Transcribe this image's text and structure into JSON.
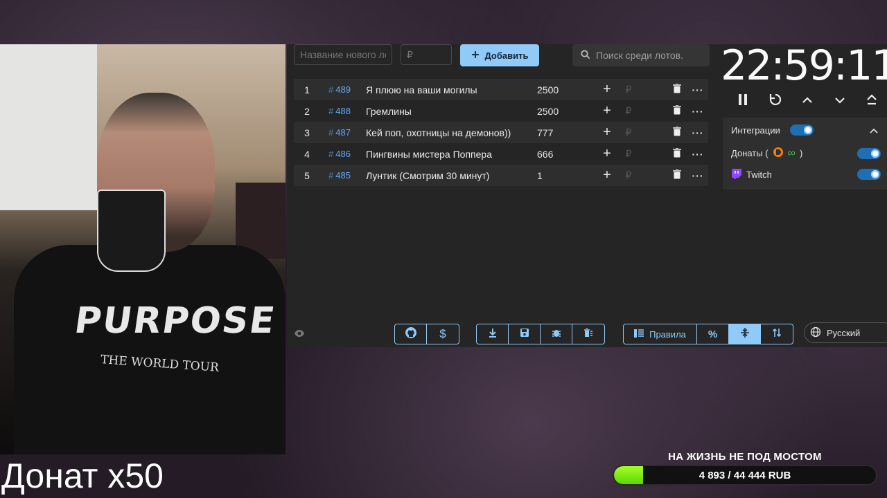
{
  "webcam": {
    "shirt_print": "PURPOSE",
    "shirt_sub": "THE WORLD TOUR"
  },
  "overlay_text": "Донат x50",
  "form": {
    "name_placeholder": "Название нового лота",
    "price_placeholder": "₽",
    "add_label": "Добавить"
  },
  "search": {
    "placeholder": "Поиск среди лотов."
  },
  "lots": [
    {
      "index": "1",
      "id": "489",
      "name": "Я плюю на ваши могилы",
      "amount": "2500"
    },
    {
      "index": "2",
      "id": "488",
      "name": "Гремлины",
      "amount": "2500"
    },
    {
      "index": "3",
      "id": "487",
      "name": "Кей поп, охотницы на демонов))",
      "amount": "777"
    },
    {
      "index": "4",
      "id": "486",
      "name": "Пингвины мистера Поппера",
      "amount": "666"
    },
    {
      "index": "5",
      "id": "485",
      "name": "Лунтик (Смотрим 30 минут)",
      "amount": "1"
    }
  ],
  "lot_symbols": {
    "hash": "#",
    "rub": "₽"
  },
  "bottombar": {
    "rules_label": "Правила",
    "language": "Русский"
  },
  "timer": {
    "value": "22:59:11"
  },
  "integrations": {
    "title": "Интеграции",
    "donations_label": "Донаты (",
    "donations_suffix": ")",
    "twitch_label": "Twitch",
    "integrations_enabled": true,
    "donations_enabled": true,
    "twitch_enabled": true
  },
  "goal": {
    "title": "НА ЖИЗНЬ НЕ ПОД МОСТОМ",
    "progress_text": "4 893 / 44 444 RUB",
    "progress_fraction": 0.11
  },
  "colors": {
    "accent": "#90caf9",
    "goal_fill": "#7cf00a",
    "twitch": "#9146ff"
  }
}
